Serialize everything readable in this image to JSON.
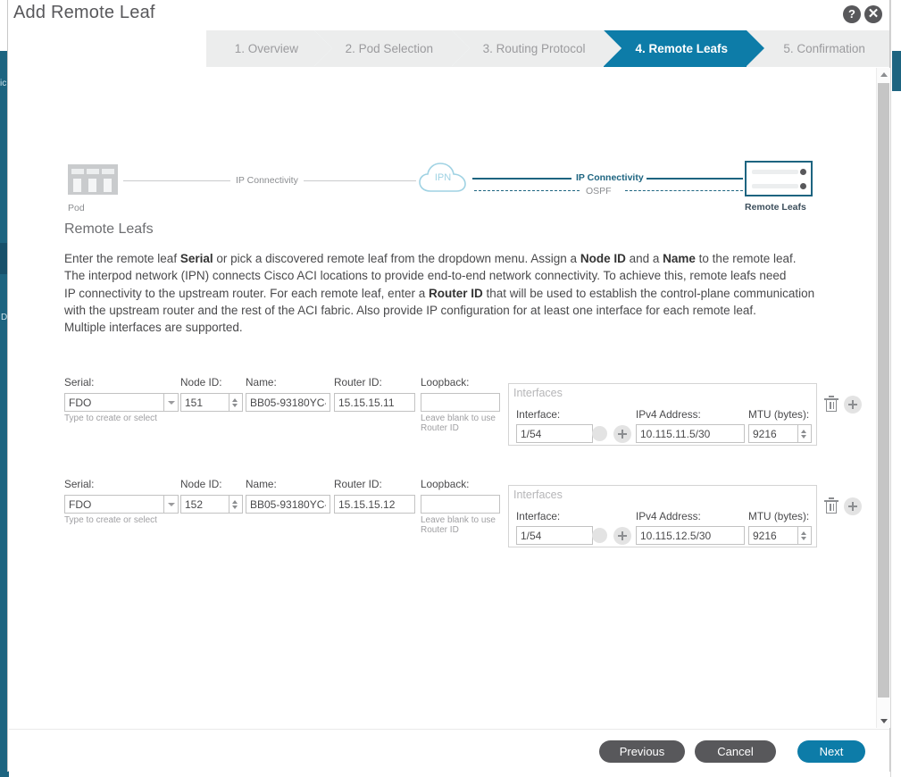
{
  "background": {
    "sidebar_fragment_top": "ic",
    "sidebar_fragment_bottom": "D"
  },
  "modal": {
    "title": "Add Remote Leaf",
    "help_label": "?",
    "close_label": "✕"
  },
  "stepper": {
    "steps": [
      {
        "label": "1. Overview",
        "active": false
      },
      {
        "label": "2. Pod Selection",
        "active": false
      },
      {
        "label": "3. Routing Protocol",
        "active": false
      },
      {
        "label": "4. Remote Leafs",
        "active": true
      },
      {
        "label": "5. Confirmation",
        "active": false
      }
    ],
    "active_color": "#0d7ca8",
    "inactive_color": "#eceded"
  },
  "topology": {
    "pod_label": "Pod",
    "left_link_label": "IP Connectivity",
    "cloud_label": "IPN",
    "right_link_label": "IP Connectivity",
    "right_link_sublabel": "OSPF",
    "remote_leafs_label": "Remote Leafs",
    "accent_color": "#1d6480"
  },
  "section": {
    "title": "Remote Leafs",
    "paragraph_line1_a": "Enter the remote leaf ",
    "paragraph_line1_b": "Serial",
    "paragraph_line1_c": " or pick a discovered remote leaf from the dropdown menu. Assign a ",
    "paragraph_line1_d": "Node ID",
    "paragraph_line1_e": " and a ",
    "paragraph_line1_f": "Name",
    "paragraph_line1_g": " to the remote leaf.",
    "paragraph_line2": "The interpod network (IPN) connects Cisco ACI locations to provide end-to-end network connectivity. To achieve this, remote leafs need",
    "paragraph_line3_a": "IP connectivity to the upstream router. For each remote leaf, enter a ",
    "paragraph_line3_b": "Router ID",
    "paragraph_line3_c": " that will be used to establish the control-plane communication",
    "paragraph_line4": "with the upstream router and the rest of the ACI fabric. Also provide IP configuration for at least one interface for each remote leaf.",
    "paragraph_line5": "Multiple interfaces are supported."
  },
  "form": {
    "labels": {
      "serial": "Serial:",
      "node_id": "Node ID:",
      "name": "Name:",
      "router_id": "Router ID:",
      "loopback": "Loopback:",
      "interfaces_panel": "Interfaces",
      "interface": "Interface:",
      "ipv4_address": "IPv4 Address:",
      "mtu": "MTU (bytes):"
    },
    "hints": {
      "serial": "Type to create or select",
      "loopback_line1": "Leave blank to use",
      "loopback_line2": "Router ID"
    },
    "rows": [
      {
        "serial": "FDO",
        "node_id": "151",
        "name": "BB05-93180YC-",
        "router_id": "15.15.15.11",
        "loopback": "",
        "interface": "1/54",
        "ipv4_address": "10.115.11.5/30",
        "mtu": "9216"
      },
      {
        "serial": "FDO",
        "node_id": "152",
        "name": "BB05-93180YC-",
        "router_id": "15.15.15.12",
        "loopback": "",
        "interface": "1/54",
        "ipv4_address": "10.115.12.5/30",
        "mtu": "9216"
      }
    ]
  },
  "footer": {
    "previous_label": "Previous",
    "cancel_label": "Cancel",
    "next_label": "Next",
    "primary_color": "#0d7ca8",
    "secondary_color": "#58585b"
  }
}
